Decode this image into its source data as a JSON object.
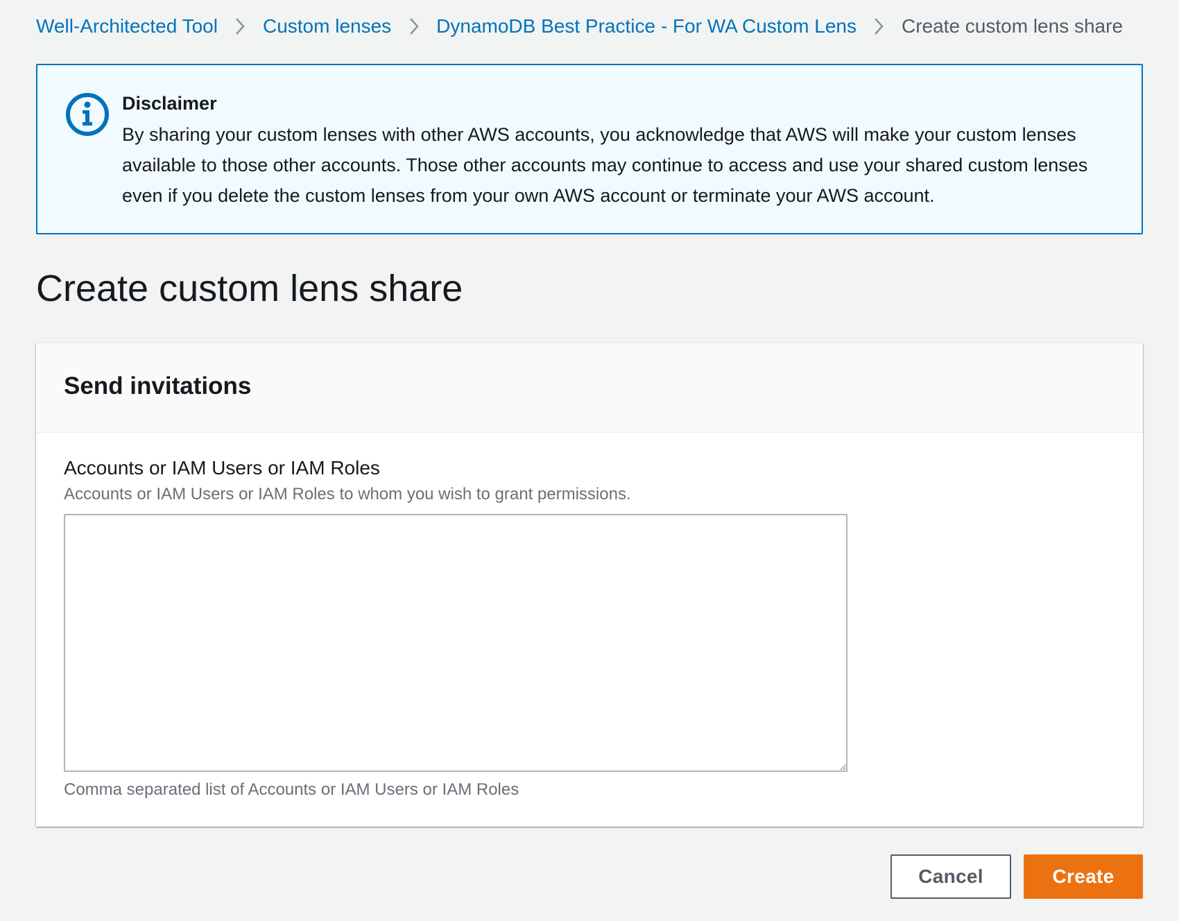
{
  "breadcrumb": {
    "items": [
      {
        "label": "Well-Architected Tool"
      },
      {
        "label": "Custom lenses"
      },
      {
        "label": "DynamoDB Best Practice - For WA Custom Lens"
      }
    ],
    "current": "Create custom lens share",
    "separator_icon": "chevron-right-icon"
  },
  "disclaimer": {
    "icon": "info-icon",
    "title": "Disclaimer",
    "text": "By sharing your custom lenses with other AWS accounts, you acknowledge that AWS will make your custom lenses available to those other accounts. Those other accounts may continue to access and use your shared custom lenses even if you delete the custom lenses from your own AWS account or terminate your AWS account."
  },
  "page": {
    "title": "Create custom lens share"
  },
  "send_invitations": {
    "title": "Send invitations",
    "field": {
      "label": "Accounts or IAM Users or IAM Roles",
      "description": "Accounts or IAM Users or IAM Roles to whom you wish to grant permissions.",
      "value": "",
      "placeholder": "",
      "constraint": "Comma separated list of Accounts or IAM Users or IAM Roles"
    }
  },
  "actions": {
    "cancel_label": "Cancel",
    "create_label": "Create"
  },
  "colors": {
    "link": "#0073bb",
    "primary_button": "#ec7211",
    "info_background": "#f1faff",
    "info_border": "#0073bb",
    "page_background": "#f2f3f3"
  }
}
